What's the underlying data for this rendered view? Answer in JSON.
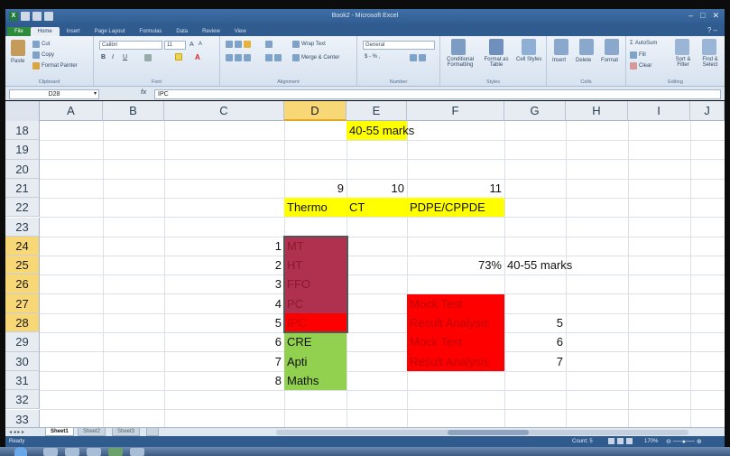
{
  "window": {
    "title": "Book2 - Microsoft Excel"
  },
  "ribbon": {
    "tabs": [
      "File",
      "Home",
      "Insert",
      "Page Layout",
      "Formulas",
      "Data",
      "Review",
      "View"
    ],
    "clipboard": {
      "cut": "Cut",
      "copy": "Copy",
      "paste": "Paste",
      "painter": "Format Painter",
      "label": "Clipboard"
    },
    "font": {
      "name": "Calibri",
      "size": "11",
      "label": "Font"
    },
    "alignment": {
      "wrap": "Wrap Text",
      "merge": "Merge & Center",
      "label": "Alignment"
    },
    "number": {
      "format": "General",
      "label": "Number"
    },
    "styles": {
      "conditional": "Conditional Formatting",
      "table": "Format as Table",
      "cell": "Cell Styles",
      "label": "Styles"
    },
    "cells": {
      "insert": "Insert",
      "delete": "Delete",
      "format": "Format",
      "label": "Cells"
    },
    "editing": {
      "autosum": "AutoSum",
      "fill": "Fill",
      "clear": "Clear",
      "sort": "Sort & Filter",
      "find": "Find & Select",
      "label": "Editing"
    }
  },
  "formula_bar": {
    "name_box": "D28",
    "fx": "fx",
    "formula": "IPC"
  },
  "columns": [
    "A",
    "B",
    "C",
    "D",
    "E",
    "F",
    "G",
    "H",
    "I",
    "J"
  ],
  "rows": [
    "18",
    "19",
    "20",
    "21",
    "22",
    "23",
    "24",
    "25",
    "26",
    "27",
    "28",
    "29",
    "30",
    "31",
    "32",
    "33"
  ],
  "cells": {
    "E18": "40-55 marks",
    "D21": "9",
    "E21": "10",
    "F21": "11",
    "D22": "Thermo",
    "E22": "CT",
    "F22": "PDPE/CPPDE",
    "C24": "1",
    "D24": "MT",
    "C25": "2",
    "D25": "HT",
    "F25": "73%",
    "G25": "40-55 marks",
    "C26": "3",
    "D26": "FFO",
    "C27": "4",
    "D27": "PC",
    "F27": "Mock Test",
    "C28": "5",
    "D28": "IPC",
    "F28": "Result Analysis",
    "G28": "5",
    "C29": "6",
    "D29": "CRE",
    "F29": "Mock Test",
    "G29": "6",
    "C30": "7",
    "D30": "Apti",
    "F30": "Result Analysis",
    "G30": "7",
    "C31": "8",
    "D31": "Maths"
  },
  "colors": {
    "yellow": "#ffff00",
    "maroon": "#b0304f",
    "red": "#ff0000",
    "green": "#92d050",
    "selected_header": "#f8d776"
  },
  "sheets": [
    "Sheet1",
    "Sheet2",
    "Sheet3"
  ],
  "status": {
    "mode": "Ready",
    "count": "Count: 5",
    "zoom": "170%"
  }
}
